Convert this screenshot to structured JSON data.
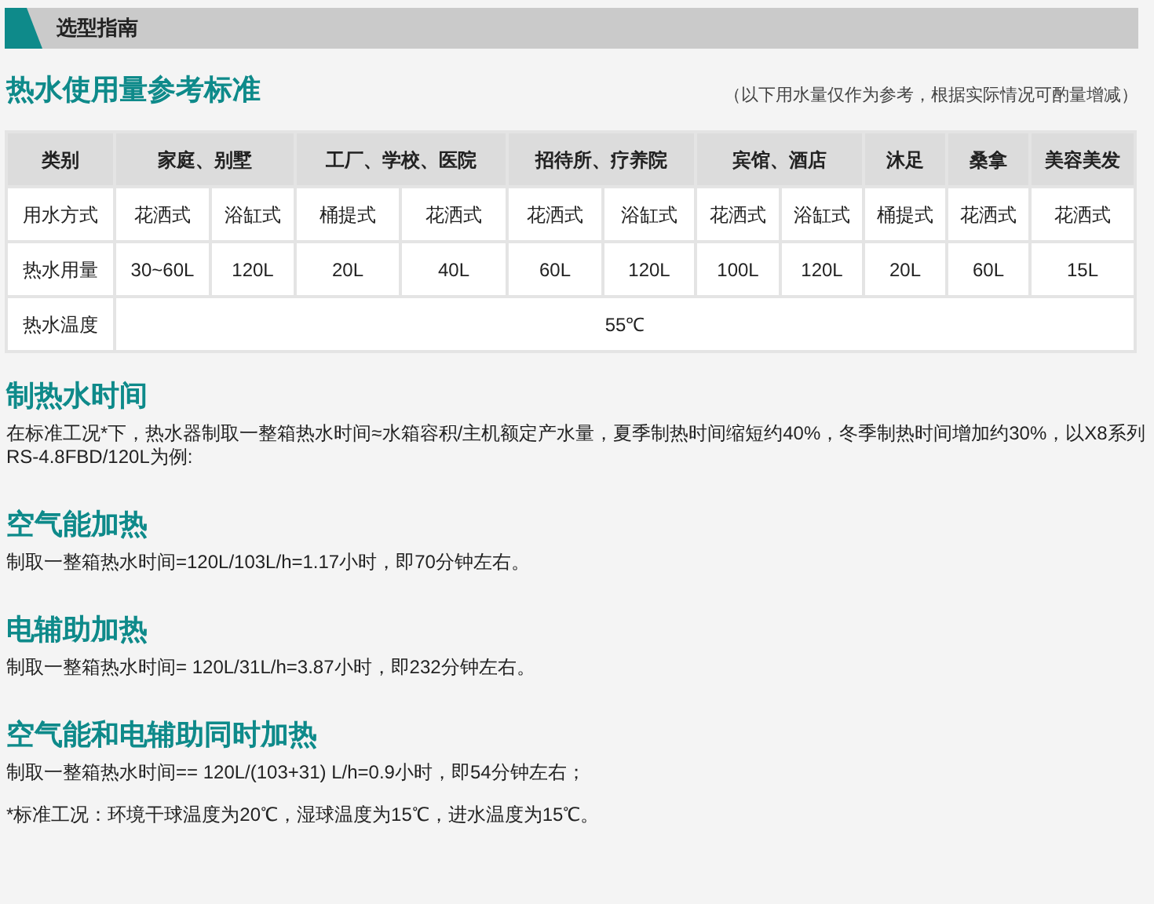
{
  "section_bar": {
    "title": "选型指南"
  },
  "usage": {
    "title": "热水使用量参考标准",
    "note": "（以下用水量仅作为参考，根据实际情况可酌量增减）",
    "table": {
      "corner": "类别",
      "method_label": "用水方式",
      "amount_label": "热水用量",
      "temperature_label": "热水温度",
      "temperature": "55℃",
      "categories": [
        {
          "label": "家庭、别墅",
          "uses": [
            {
              "method": "花洒式",
              "amount": "30~60L"
            },
            {
              "method": "浴缸式",
              "amount": "120L"
            }
          ]
        },
        {
          "label": "工厂、学校、医院",
          "uses": [
            {
              "method": "桶提式",
              "amount": "20L"
            },
            {
              "method": "花洒式",
              "amount": "40L"
            }
          ]
        },
        {
          "label": "招待所、疗养院",
          "uses": [
            {
              "method": "花洒式",
              "amount": "60L"
            },
            {
              "method": "浴缸式",
              "amount": "120L"
            }
          ]
        },
        {
          "label": "宾馆、酒店",
          "uses": [
            {
              "method": "花洒式",
              "amount": "100L"
            },
            {
              "method": "浴缸式",
              "amount": "120L"
            }
          ]
        },
        {
          "label": "沐足",
          "uses": [
            {
              "method": "桶提式",
              "amount": "20L"
            }
          ]
        },
        {
          "label": "桑拿",
          "uses": [
            {
              "method": "花洒式",
              "amount": "60L"
            }
          ]
        },
        {
          "label": "美容美发",
          "uses": [
            {
              "method": "花洒式",
              "amount": "15L"
            }
          ]
        }
      ]
    }
  },
  "sections": [
    {
      "title": "制热水时间",
      "paragraphs": [
        "在标准工况*下，热水器制取一整箱热水时间≈水箱容积/主机额定产水量，夏季制热时间缩短约40%，冬季制热时间增加约30%，以X8系列RS-4.8FBD/120L为例:"
      ]
    },
    {
      "title": "空气能加热",
      "paragraphs": [
        "制取一整箱热水时间=120L/103L/h=1.17小时，即70分钟左右。"
      ]
    },
    {
      "title": "电辅助加热",
      "paragraphs": [
        "制取一整箱热水时间= 120L/31L/h=3.87小时，即232分钟左右。"
      ]
    },
    {
      "title": "空气能和电辅助同时加热",
      "paragraphs": [
        "制取一整箱热水时间== 120L/(103+31) L/h=0.9小时，即54分钟左右；",
        "*标准工况：环境干球温度为20℃，湿球温度为15℃，进水温度为15℃。"
      ]
    }
  ]
}
